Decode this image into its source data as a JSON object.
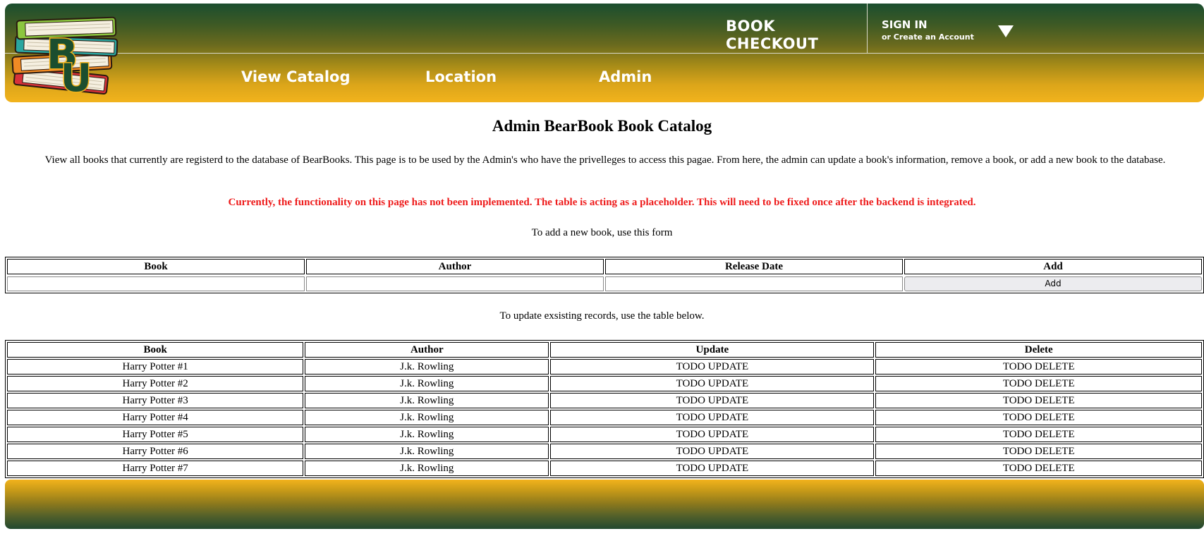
{
  "header": {
    "brand_title": "BOOK\nCHECKOUT",
    "signin_label": "SIGN IN",
    "create_account_label": "or Create an Account",
    "logo_letters": "BU",
    "nav": [
      {
        "label": "View Catalog"
      },
      {
        "label": "Location"
      },
      {
        "label": "Admin"
      }
    ]
  },
  "main": {
    "title": "Admin BearBook Book Catalog",
    "intro": "View all books that currently are registerd to the database of BearBooks. This page is to be used by the Admin's who have the privelleges to access this pagae. From here, the admin can update a book's information, remove a book, or add a new book to the database.",
    "warning": "Currently, the functionality on this page has not been implemented. The table is acting as a placeholder. This will need to be fixed once after the backend is integrated.",
    "form_caption": "To add a new book, use this form",
    "update_caption": "To update exsisting records, use the table below."
  },
  "add_form": {
    "headers": [
      "Book",
      "Author",
      "Release Date",
      "Add"
    ],
    "book_value": "",
    "author_value": "",
    "release_date_value": "",
    "add_button_label": "Add"
  },
  "records": {
    "headers": [
      "Book",
      "Author",
      "Update",
      "Delete"
    ],
    "rows": [
      {
        "book": "Harry Potter #1",
        "author": "J.k. Rowling",
        "update": "TODO UPDATE",
        "delete": "TODO DELETE"
      },
      {
        "book": "Harry Potter #2",
        "author": "J.k. Rowling",
        "update": "TODO UPDATE",
        "delete": "TODO DELETE"
      },
      {
        "book": "Harry Potter #3",
        "author": "J.k. Rowling",
        "update": "TODO UPDATE",
        "delete": "TODO DELETE"
      },
      {
        "book": "Harry Potter #4",
        "author": "J.k. Rowling",
        "update": "TODO UPDATE",
        "delete": "TODO DELETE"
      },
      {
        "book": "Harry Potter #5",
        "author": "J.k. Rowling",
        "update": "TODO UPDATE",
        "delete": "TODO DELETE"
      },
      {
        "book": "Harry Potter #6",
        "author": "J.k. Rowling",
        "update": "TODO UPDATE",
        "delete": "TODO DELETE"
      },
      {
        "book": "Harry Potter #7",
        "author": "J.k. Rowling",
        "update": "TODO UPDATE",
        "delete": "TODO DELETE"
      }
    ]
  },
  "colors": {
    "brand_green": "#1b4e2f",
    "brand_gold": "#f2b31c",
    "warning_red": "#ee1b1b"
  },
  "icons": {
    "logo": "book-stack-logo-icon",
    "account_menu": "caret-down-icon"
  }
}
